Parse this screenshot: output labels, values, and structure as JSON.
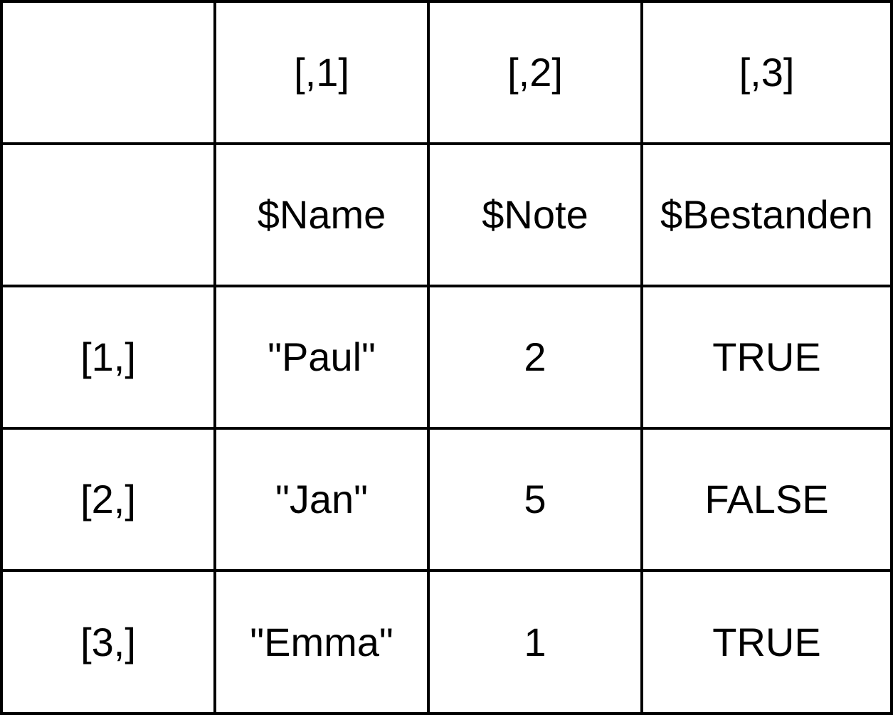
{
  "column_index_row": [
    "",
    "[,1]",
    "[,2]",
    "[,3]"
  ],
  "column_name_row": [
    "",
    "$Name",
    "$Note",
    "$Bestanden"
  ],
  "data_rows": [
    {
      "index": "[1,]",
      "cells": [
        "\"Paul\"",
        "2",
        "TRUE"
      ]
    },
    {
      "index": "[2,]",
      "cells": [
        "\"Jan\"",
        "5",
        "FALSE"
      ]
    },
    {
      "index": "[3,]",
      "cells": [
        "\"Emma\"",
        "1",
        "TRUE"
      ]
    }
  ]
}
